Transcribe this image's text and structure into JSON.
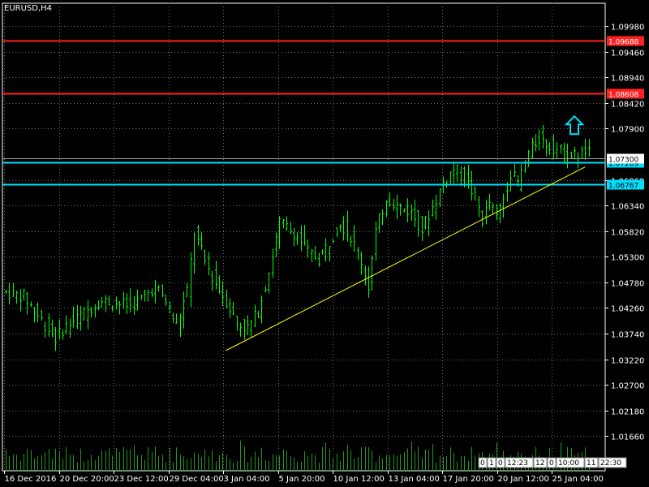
{
  "symbol_label": "EURUSD,H4",
  "colors": {
    "background": "#000000",
    "grid": "#6b6b6b",
    "candle": "#00ff00",
    "volume": "#1e9a1e",
    "resistance": "#ff2020",
    "support": "#00e0ff",
    "trendline": "#ffff00",
    "arrow": "#00e0ff",
    "axis_text": "#ffffff"
  },
  "chart_data": {
    "type": "candlestick",
    "symbol": "EURUSD",
    "timeframe": "H4",
    "ylim": [
      1.0096,
      1.1044
    ],
    "y_ticks": [
      "1.09980",
      "1.09460",
      "1.08940",
      "1.08420",
      "1.07900",
      "1.06860",
      "1.06340",
      "1.05820",
      "1.05300",
      "1.04780",
      "1.04260",
      "1.03740",
      "1.03220",
      "1.02700",
      "1.02180",
      "1.01660"
    ],
    "x_ticks": [
      "16 Dec 2016",
      "20 Dec 20:00",
      "23 Dec 12:00",
      "29 Dec 04:00",
      "3 Jan 04:00",
      "5 Jan 20:00",
      "10 Jan 12:00",
      "13 Jan 04:00",
      "17 Jan 20:00",
      "20 Jan 12:00",
      "25 Jan 04:00"
    ],
    "close_profile": [
      [
        0,
        1.046
      ],
      [
        6,
        1.045
      ],
      [
        12,
        1.0392
      ],
      [
        15,
        1.0365
      ],
      [
        18,
        1.039
      ],
      [
        22,
        1.041
      ],
      [
        27,
        1.044
      ],
      [
        31,
        1.0438
      ],
      [
        36,
        1.043
      ],
      [
        40,
        1.045
      ],
      [
        43,
        1.047
      ],
      [
        46,
        1.044
      ],
      [
        49,
        1.039
      ],
      [
        52,
        1.046
      ],
      [
        54,
        1.058
      ],
      [
        57,
        1.052
      ],
      [
        60,
        1.0475
      ],
      [
        63,
        1.044
      ],
      [
        66,
        1.0395
      ],
      [
        69,
        1.0385
      ],
      [
        72,
        1.042
      ],
      [
        75,
        1.05
      ],
      [
        78,
        1.06
      ],
      [
        82,
        1.058
      ],
      [
        86,
        1.054
      ],
      [
        89,
        1.0525
      ],
      [
        92,
        1.056
      ],
      [
        95,
        1.06
      ],
      [
        98,
        1.057
      ],
      [
        101,
        1.052
      ],
      [
        103,
        1.047
      ],
      [
        105,
        1.058
      ],
      [
        108,
        1.065
      ],
      [
        112,
        1.063
      ],
      [
        115,
        1.062
      ],
      [
        118,
        1.0585
      ],
      [
        121,
        1.063
      ],
      [
        124,
        1.068
      ],
      [
        127,
        1.071
      ],
      [
        130,
        1.069
      ],
      [
        133,
        1.065
      ],
      [
        135,
        1.0605
      ],
      [
        137,
        1.064
      ],
      [
        139,
        1.061
      ],
      [
        141,
        1.065
      ],
      [
        143,
        1.07
      ],
      [
        145,
        1.068
      ],
      [
        148,
        1.074
      ],
      [
        151,
        1.077
      ],
      [
        154,
        1.0755
      ],
      [
        157,
        1.0745
      ],
      [
        159,
        1.073
      ],
      [
        162,
        1.074
      ]
    ],
    "price_lines": [
      {
        "value": 1.09688,
        "label": "1.09688",
        "kind": "resistance"
      },
      {
        "value": 1.08608,
        "label": "1.08608",
        "kind": "resistance"
      },
      {
        "value": 1.07209,
        "label": "1.07209",
        "kind": "support"
      },
      {
        "value": 1.06767,
        "label": "1.06767",
        "kind": "support"
      }
    ],
    "current_price": {
      "label": "1.07300",
      "value": 1.073
    },
    "trendline": {
      "from": {
        "bar": 62,
        "price": 1.034
      },
      "to": {
        "bar": 163,
        "price": 1.0712
      }
    },
    "arrow": {
      "direction": "up",
      "bar": 160,
      "price": 1.0795
    },
    "session_labels": [
      "0",
      "1",
      "0",
      "12:23",
      "12",
      "0",
      "10:00",
      "11",
      "22:30"
    ]
  }
}
